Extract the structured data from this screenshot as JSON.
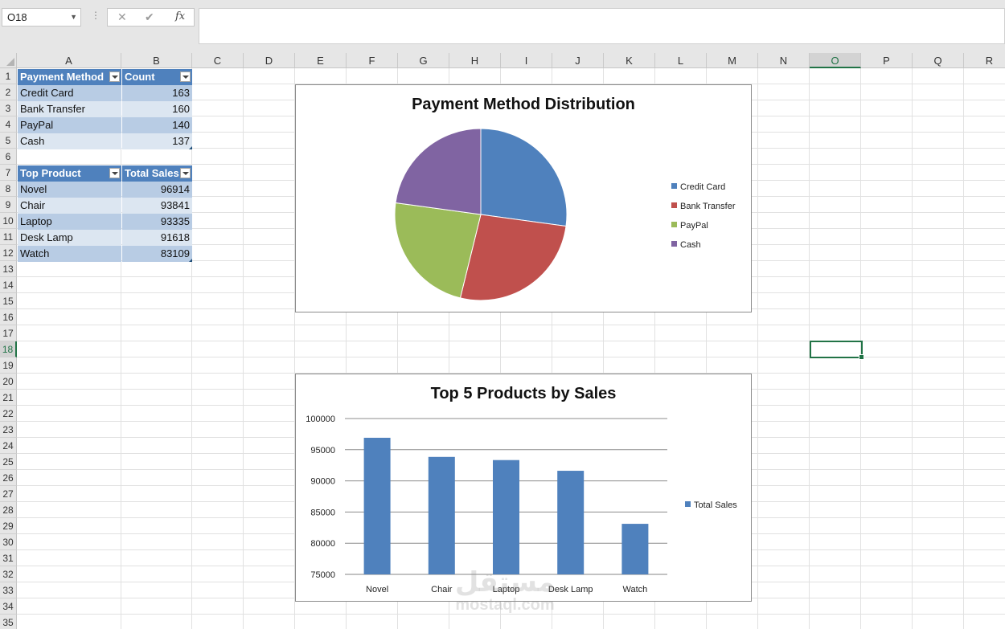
{
  "formula_bar": {
    "name_box": "O18",
    "cancel_icon": "✕",
    "enter_icon": "✔",
    "fx_label": "fx",
    "formula": ""
  },
  "columns": [
    "A",
    "B",
    "C",
    "D",
    "E",
    "F",
    "G",
    "H",
    "I",
    "J",
    "K",
    "L",
    "M",
    "N",
    "O",
    "P",
    "Q",
    "R"
  ],
  "rows": [
    "1",
    "2",
    "3",
    "4",
    "5",
    "6",
    "7",
    "8",
    "9",
    "10",
    "11",
    "12",
    "13",
    "14",
    "15",
    "16",
    "17",
    "18",
    "19",
    "20",
    "21",
    "22",
    "23",
    "24",
    "25",
    "26",
    "27",
    "28",
    "29",
    "30",
    "31",
    "32",
    "33",
    "34",
    "35"
  ],
  "selected_cell": {
    "column": "O",
    "row": "18"
  },
  "table1": {
    "headers": [
      "Payment Method",
      "Count"
    ],
    "rows": [
      [
        "Credit Card",
        "163"
      ],
      [
        "Bank Transfer",
        "160"
      ],
      [
        "PayPal",
        "140"
      ],
      [
        "Cash",
        "137"
      ]
    ]
  },
  "table2": {
    "headers": [
      "Top Product",
      "Total Sales"
    ],
    "rows": [
      [
        "Novel",
        "96914"
      ],
      [
        "Chair",
        "93841"
      ],
      [
        "Laptop",
        "93335"
      ],
      [
        "Desk Lamp",
        "91618"
      ],
      [
        "Watch",
        "83109"
      ]
    ]
  },
  "chart_data": [
    {
      "type": "pie",
      "title": "Payment Method Distribution",
      "categories": [
        "Credit Card",
        "Bank Transfer",
        "PayPal",
        "Cash"
      ],
      "values": [
        163,
        160,
        140,
        137
      ],
      "colors": [
        "#4f81bd",
        "#c0504d",
        "#9bbb59",
        "#8064a2"
      ],
      "legend": "right"
    },
    {
      "type": "bar",
      "title": "Top 5 Products by Sales",
      "categories": [
        "Novel",
        "Chair",
        "Laptop",
        "Desk Lamp",
        "Watch"
      ],
      "series": [
        {
          "name": "Total Sales",
          "values": [
            96914,
            93841,
            93335,
            91618,
            83109
          ]
        }
      ],
      "ylim": [
        75000,
        100000
      ],
      "yticks": [
        "75000",
        "80000",
        "85000",
        "90000",
        "95000",
        "100000"
      ],
      "grid": true,
      "legend": "right",
      "color": "#4f81bd"
    }
  ],
  "watermark": {
    "arabic": "مستقل",
    "latin": "mostaql.com"
  }
}
